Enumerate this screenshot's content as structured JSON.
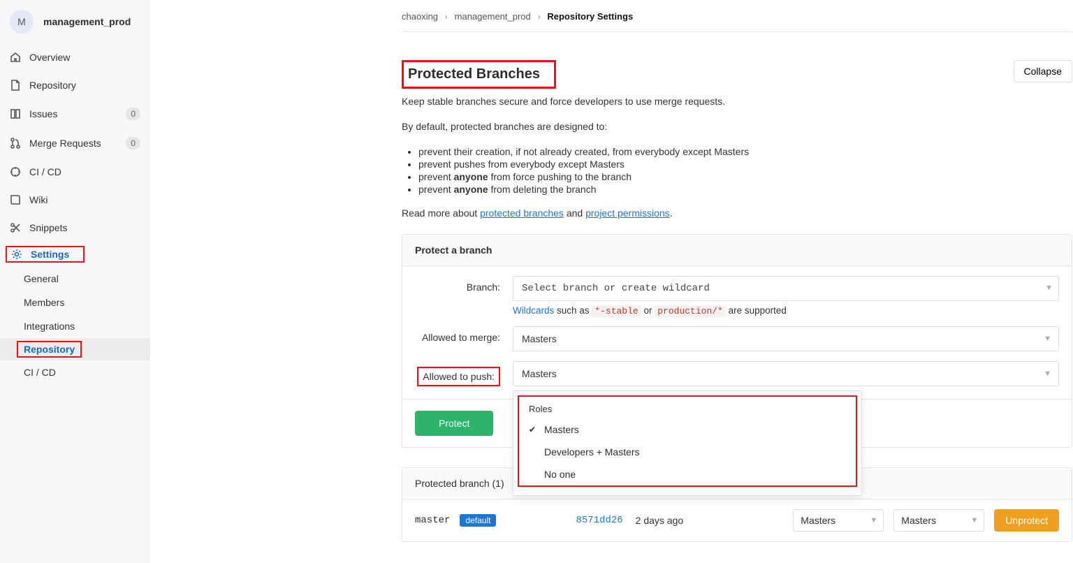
{
  "project": {
    "avatar_letter": "M",
    "name": "management_prod"
  },
  "sidebar": {
    "overview": "Overview",
    "repository": "Repository",
    "issues": {
      "label": "Issues",
      "count": "0"
    },
    "merge_requests": {
      "label": "Merge Requests",
      "count": "0"
    },
    "cicd": "CI / CD",
    "wiki": "Wiki",
    "snippets": "Snippets",
    "settings": "Settings",
    "subs": {
      "general": "General",
      "members": "Members",
      "integrations": "Integrations",
      "repository": "Repository",
      "cicd": "CI / CD"
    }
  },
  "breadcrumbs": {
    "a": "chaoxing",
    "b": "management_prod",
    "c": "Repository Settings"
  },
  "section": {
    "title": "Protected Branches",
    "collapse": "Collapse",
    "lead": "Keep stable branches secure and force developers to use merge requests.",
    "intro": "By default, protected branches are designed to:",
    "bullets": {
      "b1": "prevent their creation, if not already created, from everybody except Masters",
      "b2": "prevent pushes from everybody except Masters",
      "b3_pre": "prevent ",
      "b3_bold": "anyone",
      "b3_post": " from force pushing to the branch",
      "b4_pre": "prevent ",
      "b4_bold": "anyone",
      "b4_post": " from deleting the branch"
    },
    "read_more_pre": "Read more about ",
    "read_more_link1": "protected branches",
    "read_more_mid": " and ",
    "read_more_link2": "project permissions",
    "read_more_end": "."
  },
  "form": {
    "panel_title": "Protect a branch",
    "branch_label": "Branch:",
    "branch_placeholder": "Select branch or create wildcard",
    "wildcard_hint_link": "Wildcards",
    "wildcard_hint_1": " such as ",
    "wildcard_code1": "*-stable",
    "wildcard_hint_2": " or ",
    "wildcard_code2": "production/*",
    "wildcard_hint_3": " are supported",
    "merge_label": "Allowed to merge:",
    "merge_value": "Masters",
    "push_label": "Allowed to push:",
    "push_value": "Masters",
    "protect_btn": "Protect",
    "dropdown": {
      "title": "Roles",
      "opt1": "Masters",
      "opt2": "Developers + Masters",
      "opt3": "No one"
    }
  },
  "table": {
    "header": "Protected branch (1)",
    "branch_name": "master",
    "default_badge": "default",
    "commit": "8571dd26",
    "when": "2 days ago",
    "merge_sel": "Masters",
    "push_sel": "Masters",
    "unprotect": "Unprotect"
  }
}
